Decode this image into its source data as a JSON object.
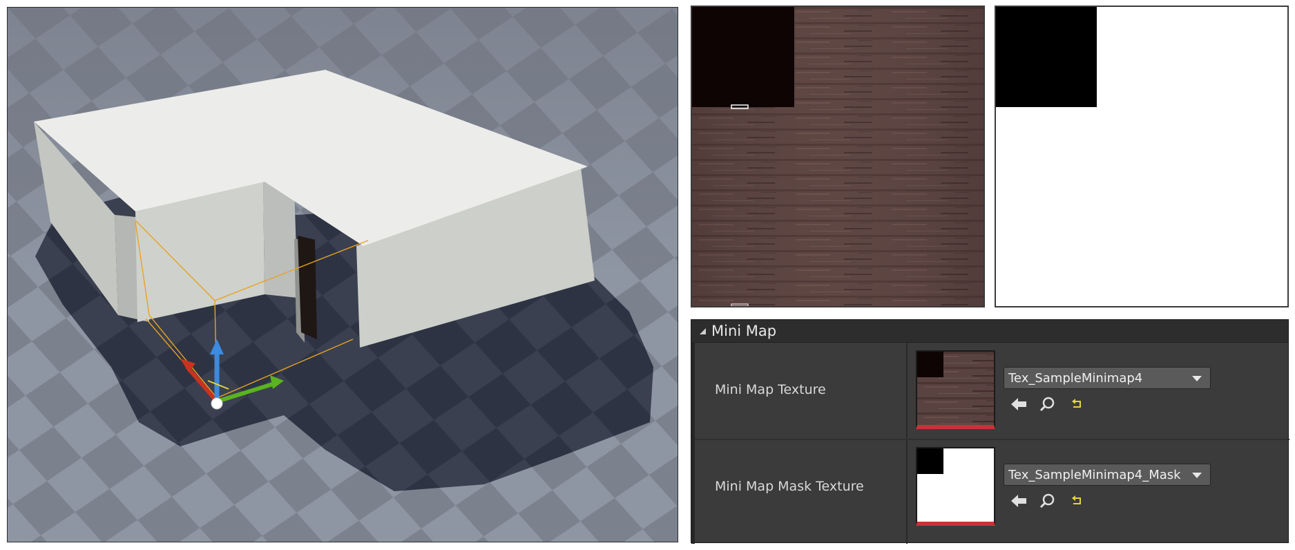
{
  "details": {
    "category": "Mini Map",
    "properties": [
      {
        "label": "Mini Map Texture",
        "asset": "Tex_SampleMinimap4",
        "thumbnail_kind": "wood-texture",
        "icons": [
          "use-selected-arrow-icon",
          "browse-magnifier-icon",
          "reset-to-default-icon"
        ]
      },
      {
        "label": "Mini Map Mask Texture",
        "asset": "Tex_SampleMinimap4_Mask",
        "thumbnail_kind": "mask-texture",
        "icons": [
          "use-selected-arrow-icon",
          "browse-magnifier-icon",
          "reset-to-default-icon"
        ]
      }
    ]
  },
  "colors": {
    "panel_bg": "#3b3b3b",
    "header_bg": "#2d2d2d",
    "combo_bg": "#5a5a5a",
    "thumb_underline": "#c8323a",
    "reset_icon": "#e6d33a",
    "gizmo_x": "#c8331f",
    "gizmo_y": "#5bb31f",
    "gizmo_z": "#3b8be0",
    "selection_outline": "#e8a321"
  }
}
